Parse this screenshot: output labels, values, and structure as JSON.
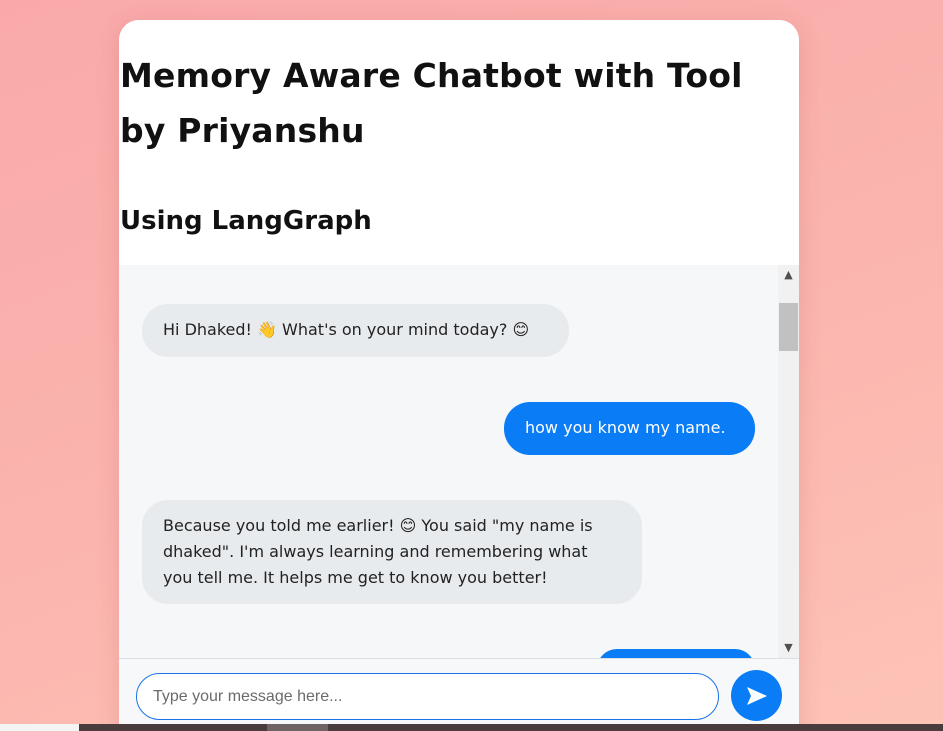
{
  "header": {
    "title": "Memory Aware Chatbot with Tool by Priyanshu",
    "subtitle": "Using LangGraph"
  },
  "messages": [
    {
      "role": "bot",
      "text": "Hi Dhaked! 👋 What's on your mind today? 😊"
    },
    {
      "role": "user",
      "text": "how you know my name."
    },
    {
      "role": "bot",
      "text": "Because you told me earlier! 😊 You said \"my name is dhaked\". I'm always learning and remembering what you tell me. It helps me get to know you better!"
    },
    {
      "role": "user",
      "text": ""
    }
  ],
  "input": {
    "placeholder": "Type your message here...",
    "value": ""
  },
  "send_button": {
    "icon": "send-icon"
  },
  "colors": {
    "accent": "#0a7cf5",
    "bot_bubble": "#e8ebee",
    "chat_background": "#f5f7f9",
    "page_background": "#f9a9a9"
  }
}
